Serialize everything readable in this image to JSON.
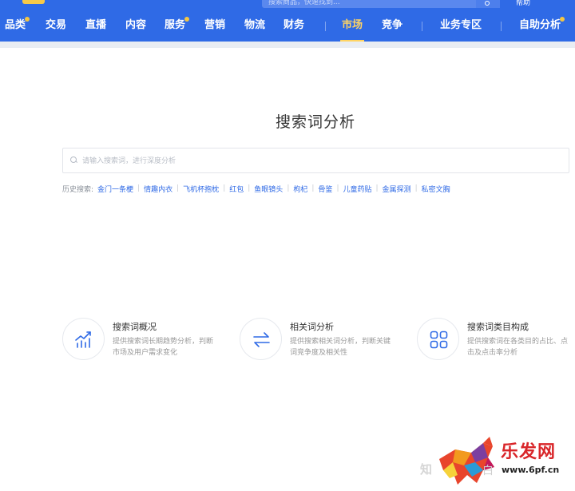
{
  "top_nav": {
    "partial_search_placeholder": "搜索商品，快速找到...",
    "partial_right_link": "帮助",
    "items": [
      {
        "label": "品类"
      },
      {
        "label": "交易"
      },
      {
        "label": "直播"
      },
      {
        "label": "内容"
      },
      {
        "label": "服务"
      },
      {
        "label": "营销"
      },
      {
        "label": "物流"
      },
      {
        "label": "财务"
      },
      {
        "label": "市场"
      },
      {
        "label": "竞争"
      },
      {
        "label": "业务专区"
      },
      {
        "label": "自助分析"
      }
    ],
    "active": "市场",
    "colors": {
      "bar": "#2f6ae6",
      "active": "#ffd463",
      "dot": "#f5c642"
    }
  },
  "main": {
    "title": "搜索词分析",
    "search": {
      "placeholder": "请输入搜索词，进行深度分析"
    },
    "history": {
      "label": "历史搜索:",
      "items": [
        "金门一条梗",
        "情趣内衣",
        "飞机杯抱枕",
        "红包",
        "鱼眼镜头",
        "枸杞",
        "骨鉴",
        "儿童药贴",
        "金属探测",
        "私密文胸"
      ]
    }
  },
  "features": [
    {
      "icon": "trend-chart-icon",
      "title": "搜索词概况",
      "desc": "提供搜索词长期趋势分析，判断市场及用户需求变化"
    },
    {
      "icon": "swap-arrows-icon",
      "title": "相关词分析",
      "desc": "提供搜索相关词分析，判断关键词竞争度及相关性"
    },
    {
      "icon": "grid-squares-icon",
      "title": "搜索词类目构成",
      "desc": "提供搜索词在各类目的占比、点击及点击率分析"
    }
  ],
  "watermark": {
    "zhihu": "知",
    "brand": "乐发网",
    "sub": "白",
    "url": "www.6pf.cn"
  },
  "colors": {
    "link": "#2f6ae6",
    "icon": "#2f6ae6"
  }
}
